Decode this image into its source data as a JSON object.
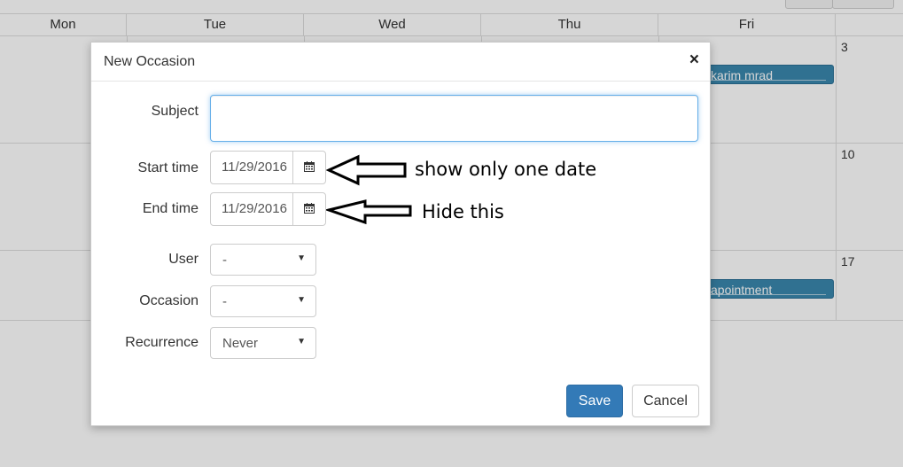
{
  "calendar": {
    "days": [
      "Mon",
      "Tue",
      "Wed",
      "Thu",
      "Fri"
    ],
    "week_numbers": [
      "3",
      "10",
      "17"
    ],
    "events": [
      {
        "label": "karim mrad"
      },
      {
        "label": "apointment"
      }
    ],
    "event_color": "#3a87ad"
  },
  "modal": {
    "title": "New Occasion",
    "close_glyph": "×",
    "subject": {
      "label": "Subject",
      "value": ""
    },
    "start_time": {
      "label": "Start time",
      "value": "11/29/2016"
    },
    "end_time": {
      "label": "End time",
      "value": "11/29/2016"
    },
    "user": {
      "label": "User",
      "value": "-"
    },
    "occasion": {
      "label": "Occasion",
      "value": "-"
    },
    "recurrence": {
      "label": "Recurrence",
      "value": "Never"
    },
    "save_label": "Save",
    "cancel_label": "Cancel",
    "primary_color": "#337ab7"
  },
  "annotations": {
    "start": "show only one date",
    "end": "Hide this"
  }
}
